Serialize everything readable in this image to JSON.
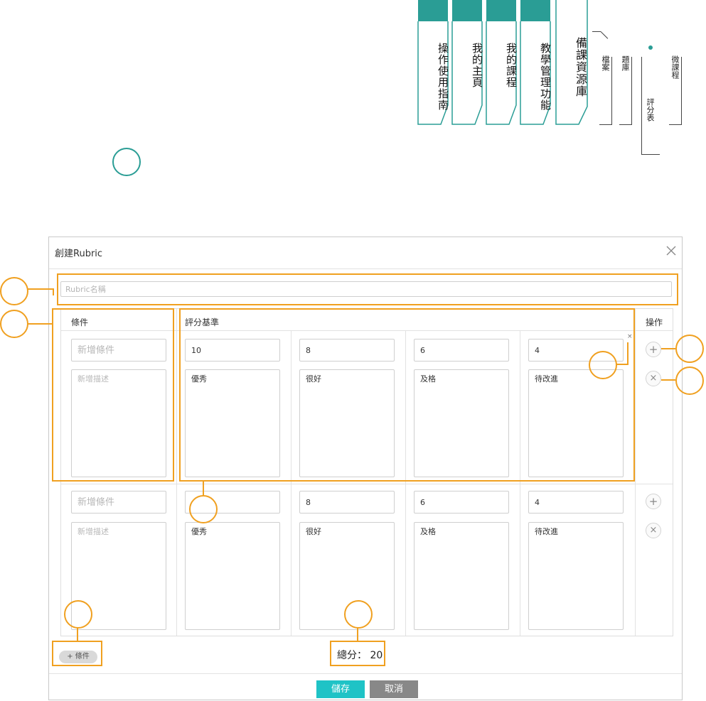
{
  "nav": {
    "tabs": [
      "操作使用指南",
      "我的主頁",
      "我的課程",
      "教學管理功能",
      "備課資源庫"
    ],
    "subs": [
      "檔案",
      "題庫",
      "評分表",
      "微課程"
    ]
  },
  "dialog": {
    "title": "創建Rubric",
    "name_placeholder": "Rubric名稱",
    "headers": {
      "condition": "條件",
      "criteria": "評分基準",
      "actions": "操作"
    },
    "rows": [
      {
        "cond_placeholder": "新增條件",
        "desc_placeholder": "新增描述",
        "levels": [
          {
            "score": "10",
            "label": "優秀"
          },
          {
            "score": "8",
            "label": "很好"
          },
          {
            "score": "6",
            "label": "及格"
          },
          {
            "score": "4",
            "label": "待改進"
          }
        ]
      },
      {
        "cond_placeholder": "新增條件",
        "desc_placeholder": "新增描述",
        "levels": [
          {
            "score": "",
            "label": "優秀"
          },
          {
            "score": "8",
            "label": "很好"
          },
          {
            "score": "6",
            "label": "及格"
          },
          {
            "score": "4",
            "label": "待改進"
          }
        ]
      }
    ],
    "add_condition": "+ 條件",
    "total": "總分： 20",
    "save": "儲存",
    "cancel": "取消",
    "remove_level_glyph": "×"
  },
  "colors": {
    "teal": "#2a9d95",
    "orange": "#f0a020",
    "save": "#1fc3c6",
    "cancel": "#888888"
  }
}
